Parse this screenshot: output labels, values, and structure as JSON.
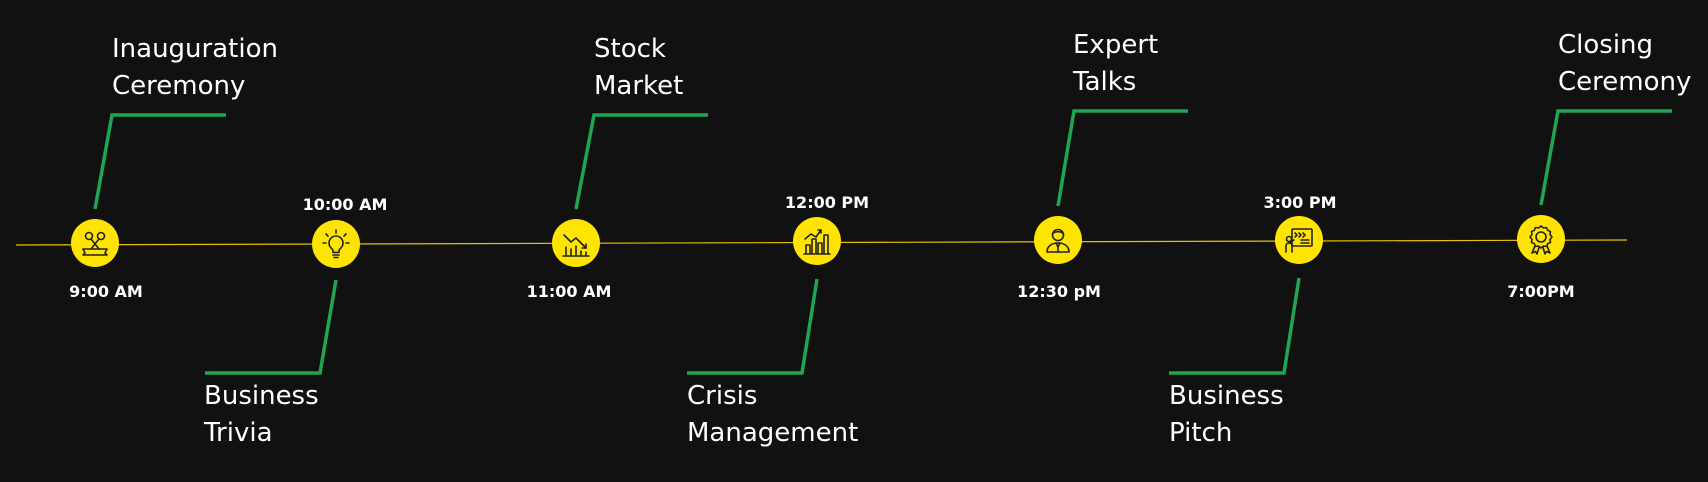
{
  "colors": {
    "background": "#111111",
    "axis": "#E6C200",
    "node": "#FFE400",
    "connector": "#1FA652",
    "text": "#FFFFFF",
    "icon_stroke": "#222222"
  },
  "events": [
    {
      "id": "e1",
      "time": "9:00 AM",
      "label_lines": [
        "Inauguration",
        "Ceremony"
      ],
      "icon": "ribbon-cutting-icon",
      "label_side": "above"
    },
    {
      "id": "e2",
      "time": "10:00 AM",
      "label_lines": [
        "Business",
        "Trivia"
      ],
      "icon": "lightbulb-icon",
      "label_side": "below"
    },
    {
      "id": "e3",
      "time": "11:00 AM",
      "label_lines": [
        "Stock",
        "Market"
      ],
      "icon": "stock-decline-icon",
      "label_side": "above"
    },
    {
      "id": "e4",
      "time": "12:00 PM",
      "label_lines": [
        "Crisis",
        "Management"
      ],
      "icon": "crisis-chart-icon",
      "label_side": "below"
    },
    {
      "id": "e5",
      "time": "12:30 pM",
      "label_lines": [
        "Expert",
        "Talks"
      ],
      "icon": "expert-person-icon",
      "label_side": "above"
    },
    {
      "id": "e6",
      "time": "3:00 PM",
      "label_lines": [
        "Business",
        "Pitch"
      ],
      "icon": "presentation-board-icon",
      "label_side": "below"
    },
    {
      "id": "e7",
      "time": "7:00PM",
      "label_lines": [
        "Closing",
        "Ceremony"
      ],
      "icon": "award-badge-icon",
      "label_side": "above"
    }
  ]
}
